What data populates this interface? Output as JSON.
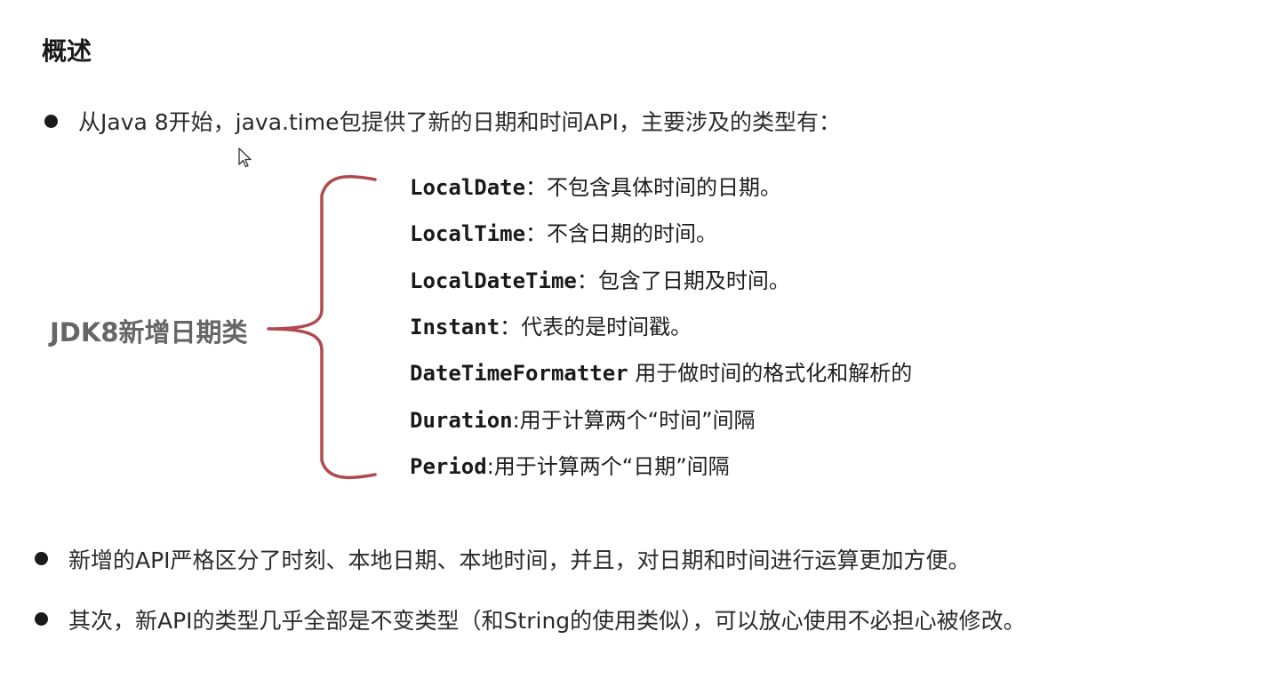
{
  "heading": "概述",
  "intro_bullet": "从Java 8开始，java.time包提供了新的日期和时间API，主要涉及的类型有：",
  "group_label": "JDK8新增日期类",
  "brace_color": "#b04a4f",
  "classes": [
    {
      "name": "LocalDate",
      "desc": "：不包含具体时间的日期。"
    },
    {
      "name": "LocalTime",
      "desc": "：不含日期的时间。"
    },
    {
      "name": "LocalDateTime",
      "desc": "：包含了日期及时间。"
    },
    {
      "name": "Instant",
      "desc": "：代表的是时间戳。"
    },
    {
      "name": "DateTimeFormatter",
      "desc": " 用于做时间的格式化和解析的"
    },
    {
      "name": "Duration",
      "desc": ":用于计算两个“时间”间隔"
    },
    {
      "name": "Period",
      "desc": ":用于计算两个“日期”间隔"
    }
  ],
  "bullets": [
    "新增的API严格区分了时刻、本地日期、本地时间，并且，对日期和时间进行运算更加方便。",
    "其次，新API的类型几乎全部是不变类型（和String的使用类似），可以放心使用不必担心被修改。"
  ],
  "icons": {
    "cursor": "mouse-pointer-icon"
  }
}
